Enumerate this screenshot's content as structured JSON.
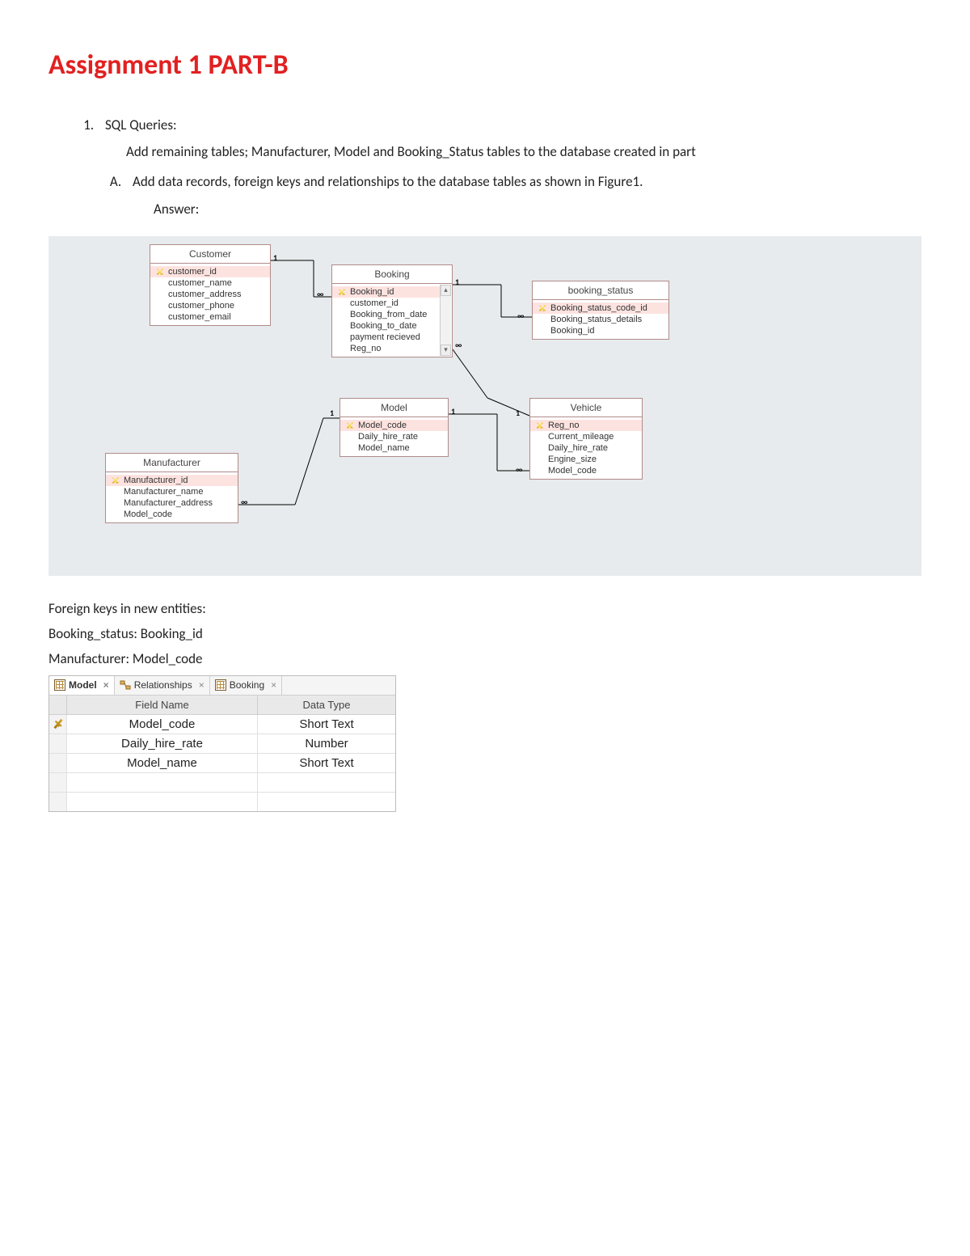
{
  "title": "Assignment 1 PART-B",
  "q1": {
    "heading": "SQL Queries:",
    "intro": "Add remaining tables; Manufacturer, Model and Booking_Status tables to the database created in part",
    "sub_a": "Add data records, foreign keys and relationships to the database tables as shown in Figure1.",
    "answer_label": "Answer:"
  },
  "entities": {
    "customer": {
      "title": "Customer",
      "fields": [
        "customer_id",
        "customer_name",
        "customer_address",
        "customer_phone",
        "customer_email"
      ]
    },
    "booking": {
      "title": "Booking",
      "fields": [
        "Booking_id",
        "customer_id",
        "Booking_from_date",
        "Booking_to_date",
        "payment recieved",
        "Reg_no"
      ]
    },
    "booking_status": {
      "title": "booking_status",
      "fields": [
        "Booking_status_code_id",
        "Booking_status_details",
        "Booking_id"
      ]
    },
    "model": {
      "title": "Model",
      "fields": [
        "Model_code",
        "Daily_hire_rate",
        "Model_name"
      ]
    },
    "vehicle": {
      "title": "Vehicle",
      "fields": [
        "Reg_no",
        "Current_mileage",
        "Daily_hire_rate",
        "Engine_size",
        "Model_code"
      ]
    },
    "manufacturer": {
      "title": "Manufacturer",
      "fields": [
        "Manufacturer_id",
        "Manufacturer_name",
        "Manufacturer_address",
        "Model_code"
      ]
    }
  },
  "rel_one": "1",
  "rel_many": "∞",
  "foreign_keys_heading": "Foreign keys in new entities:",
  "fk_booking_status": "Booking_status: Booking_id",
  "fk_manufacturer": "Manufacturer: Model_code",
  "tabs": {
    "model": "Model",
    "relationships": "Relationships",
    "booking": "Booking"
  },
  "grid": {
    "col_field": "Field Name",
    "col_type": "Data Type",
    "rows": [
      {
        "name": "Model_code",
        "type": "Short Text",
        "pk": true
      },
      {
        "name": "Daily_hire_rate",
        "type": "Number",
        "pk": false
      },
      {
        "name": "Model_name",
        "type": "Short Text",
        "pk": false
      }
    ]
  }
}
